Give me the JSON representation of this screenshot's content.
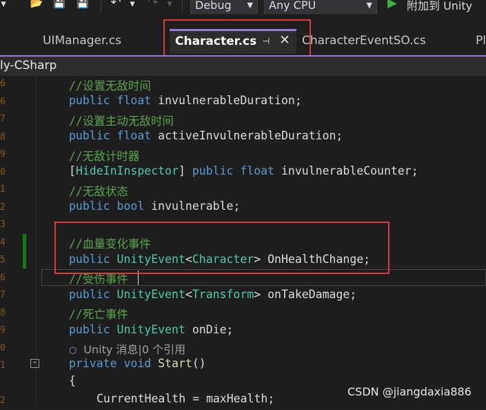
{
  "toolbar": {
    "config_combo": "Debug",
    "platform_combo": "Any CPU",
    "attach_label": "附加到 Unity"
  },
  "tabs": [
    {
      "label": "UIManager.cs"
    },
    {
      "label": "Character.cs"
    },
    {
      "label": "CharacterEventSO.cs"
    },
    {
      "label": "Pl"
    }
  ],
  "navbar": {
    "project": "ly-CSharp"
  },
  "code": {
    "c1": "//设置无敌时间",
    "l2_kw1": "public",
    "l2_kw2": "float",
    "l2_name": "invulnerableDuration;",
    "c3": "//设置主动无敌时间",
    "l4_kw1": "public",
    "l4_kw2": "float",
    "l4_name": "activeInvulnerableDuration;",
    "c5": "//无敌计时器",
    "l6_open": "[",
    "l6_attr": "HideInInspector",
    "l6_close": "]",
    "l6_kw1": "public",
    "l6_kw2": "float",
    "l6_name": "invulnerableCounter;",
    "c7": "//无敌状态",
    "l8_kw1": "public",
    "l8_kw2": "bool",
    "l8_name": "invulnerable;",
    "c9": "//血量变化事件",
    "l10_kw": "public",
    "l10_ty": "UnityEvent",
    "l10_lt": "<",
    "l10_arg": "Character",
    "l10_gt": ">",
    "l10_name": "OnHealthChange;",
    "c11": "//受伤事件",
    "l12_kw": "public",
    "l12_ty": "UnityEvent",
    "l12_lt": "<",
    "l12_arg": "Transform",
    "l12_gt": ">",
    "l12_name": "onTakeDamage;",
    "c13": "//死亡事件",
    "l14_kw": "public",
    "l14_ty": "UnityEvent",
    "l14_name": "onDie;",
    "hint": "Unity 消息|0 个引用",
    "l16_kw1": "private",
    "l16_kw2": "void",
    "l16_fn": "Start",
    "l16_paren": "()",
    "l17": "{",
    "l18_name": "CurrentHealth = maxHealth;"
  },
  "gutter": [
    "6",
    "6",
    "7",
    "8",
    "9",
    "0",
    "1",
    "2",
    "3",
    "4",
    "5",
    "6",
    "7",
    "8",
    "9",
    "0",
    "1",
    "2"
  ],
  "watermark": "CSDN @jiangdaxia886"
}
